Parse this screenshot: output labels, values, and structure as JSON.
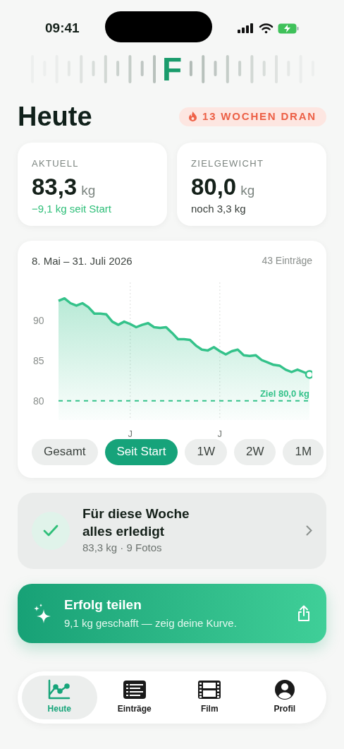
{
  "status_bar": {
    "time": "09:41"
  },
  "logo": {
    "letter": "F"
  },
  "header": {
    "title": "Heute",
    "streak": "13 WOCHEN DRAN"
  },
  "stats": [
    {
      "label": "AKTUELL",
      "value": "83,3",
      "unit": "kg",
      "note": "−9,1 kg seit Start",
      "kind": "progress"
    },
    {
      "label": "ZIELGEWICHT",
      "value": "80,0",
      "unit": "kg",
      "note": "noch 3,3 kg",
      "kind": "plain"
    }
  ],
  "chart_card": {
    "range": "8. Mai – 31. Juli 2026",
    "count": "43 Einträge",
    "chart_data": {
      "type": "area",
      "grid": true,
      "ylim": [
        77.6,
        94.8
      ],
      "yticks": [
        80,
        85,
        90
      ],
      "categories": [
        null,
        null,
        null,
        null,
        null,
        null,
        null,
        null,
        null,
        null,
        null,
        null,
        "J",
        null,
        null,
        null,
        null,
        null,
        null,
        null,
        null,
        null,
        null,
        null,
        null,
        null,
        null,
        "J",
        null,
        null,
        null,
        null,
        null,
        null,
        null,
        null,
        null,
        null,
        null,
        null,
        null,
        null,
        null
      ],
      "series": [
        {
          "color": "#34c28a",
          "values": [
            92.5,
            92.8,
            92.2,
            91.9,
            92.2,
            91.7,
            90.9,
            90.9,
            90.8,
            89.9,
            89.5,
            89.9,
            89.6,
            89.2,
            89.5,
            89.7,
            89.2,
            89.1,
            89.2,
            88.5,
            87.7,
            87.7,
            87.6,
            86.9,
            86.4,
            86.3,
            86.7,
            86.2,
            85.8,
            86.2,
            86.4,
            85.7,
            85.6,
            85.7,
            85.1,
            84.8,
            84.5,
            84.4,
            83.9,
            83.6,
            83.9,
            83.6,
            83.3
          ]
        }
      ],
      "ref_lines": [
        {
          "axis": "y",
          "value": 80,
          "label": "Ziel 80,0 kg",
          "color": "#34c28a"
        }
      ]
    },
    "filters": [
      {
        "label": "Gesamt",
        "selected": false
      },
      {
        "label": "Seit Start",
        "selected": true
      },
      {
        "label": "1W",
        "selected": false
      },
      {
        "label": "2W",
        "selected": false
      },
      {
        "label": "1M",
        "selected": false
      }
    ]
  },
  "week_card": {
    "title": "Für diese Woche alles erledigt",
    "subtitle": "83,3 kg · 9 Fotos",
    "done": true
  },
  "share_card": {
    "title": "Erfolg teilen",
    "subtitle": "9,1 kg geschafft — zeig deine Kurve."
  },
  "tab_bar": [
    {
      "label": "Heute",
      "kind": "chart",
      "selected": true
    },
    {
      "label": "Einträge",
      "kind": "list",
      "selected": false
    },
    {
      "label": "Film",
      "kind": "film",
      "selected": false
    },
    {
      "label": "Profil",
      "kind": "profile",
      "selected": false
    }
  ]
}
